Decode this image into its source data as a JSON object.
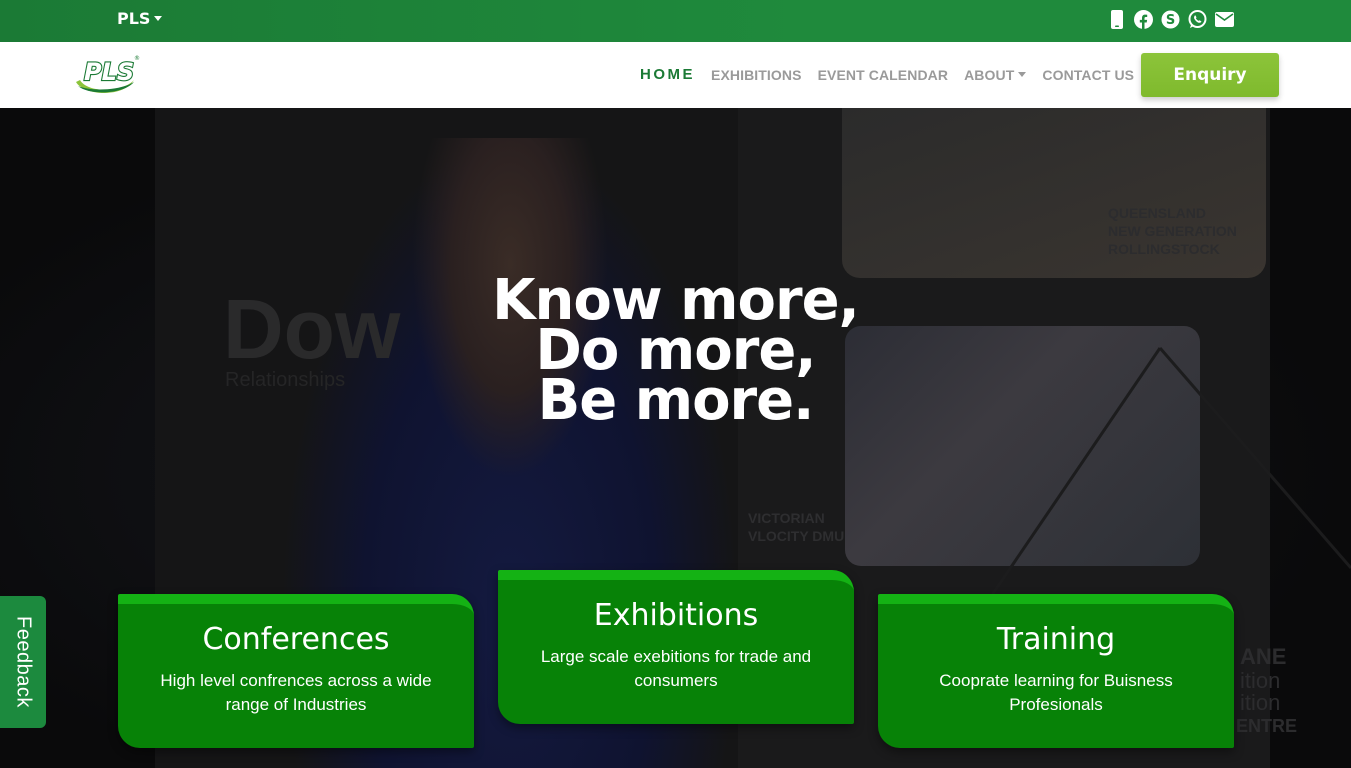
{
  "topbar": {
    "language": "PLS",
    "icons": [
      "mobile-icon",
      "facebook-icon",
      "skype-icon",
      "whatsapp-icon",
      "email-icon"
    ]
  },
  "navbar": {
    "logo_text": "PLS",
    "items": [
      {
        "label": "HOME",
        "active": true
      },
      {
        "label": "EXHIBITIONS"
      },
      {
        "label": "EVENT CALENDAR"
      },
      {
        "label": "ABOUT",
        "dropdown": true
      },
      {
        "label": "CONTACT US"
      }
    ],
    "cta": "Enquiry"
  },
  "hero": {
    "headline": [
      "Know more,",
      "Do more,",
      "Be more."
    ],
    "background_texts": [
      "Dow",
      "Relationships",
      "QUEENSLAND",
      "NEW GENERATION",
      "ROLLINGSTOCK",
      "VICTORIAN",
      "VLOCITY DMU",
      "ANE",
      "ition",
      "ition",
      "ENTRE"
    ],
    "cards": [
      {
        "title": "Conferences",
        "text": "High level confrences across a wide range of Industries"
      },
      {
        "title": "Exhibitions",
        "text": "Large scale exebitions for trade and consumers"
      },
      {
        "title": "Training",
        "text": "Cooprate learning for Buisness Profesionals"
      }
    ]
  },
  "feedback": "Feedback",
  "colors": {
    "topbar": "#1f8a3c",
    "brand_green": "#1b7a35",
    "cta": "#8cc43a",
    "card": "#078207",
    "card_accent": "#14b214"
  }
}
